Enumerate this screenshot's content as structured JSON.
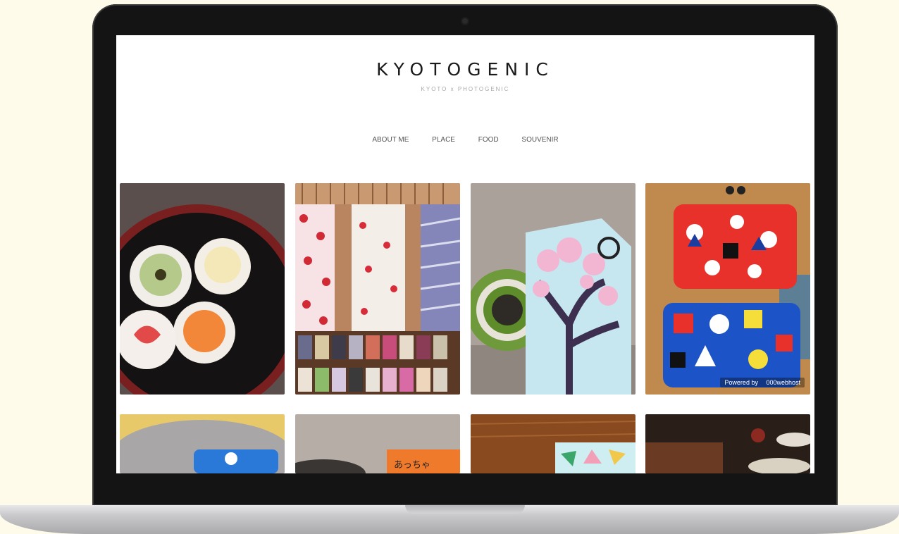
{
  "site": {
    "title": "KYOTOGENIC",
    "tagline": "KYOTO x PHOTOGENIC"
  },
  "nav": {
    "items": [
      {
        "label": "ABOUT ME"
      },
      {
        "label": "PLACE"
      },
      {
        "label": "FOOD"
      },
      {
        "label": "SOUVENIR"
      }
    ]
  },
  "gallery": {
    "badge": "Powered by  000webhost",
    "sign_text": "あっちゃ"
  },
  "colors": {
    "page_background": "#fffbea",
    "laptop_bezel": "#141414",
    "title_text": "#1a1a1a"
  }
}
